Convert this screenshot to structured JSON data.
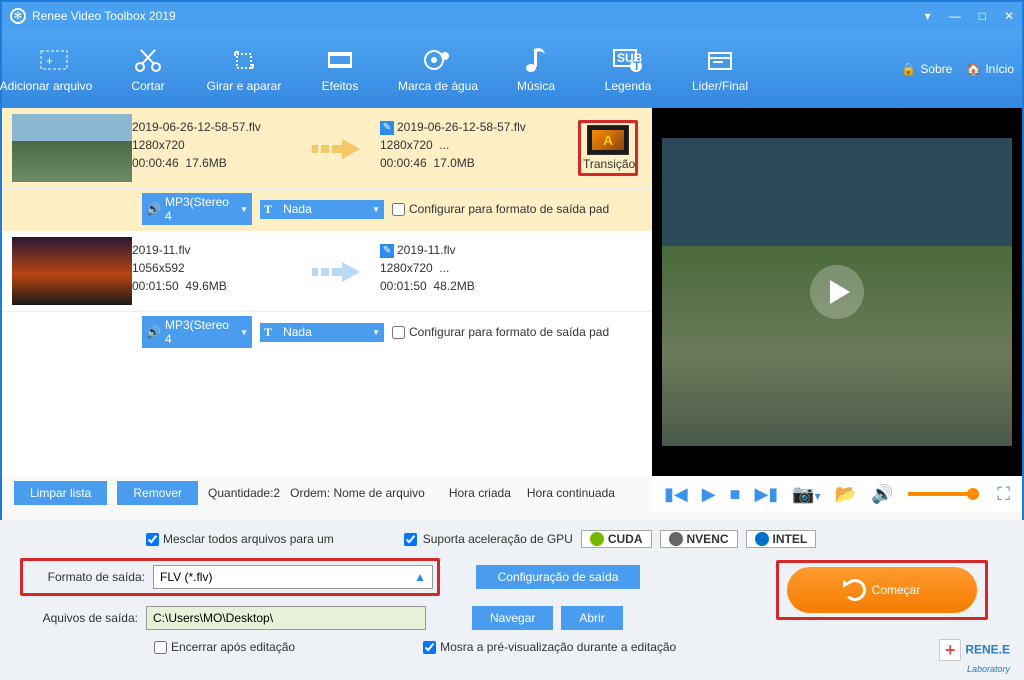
{
  "app": {
    "title": "Renee Video Toolbox 2019"
  },
  "header_right": {
    "about": "Sobre",
    "home": "Início"
  },
  "toolbar": [
    {
      "label": "Adicionar arquivo"
    },
    {
      "label": "Cortar"
    },
    {
      "label": "Girar e aparar"
    },
    {
      "label": "Efeitos"
    },
    {
      "label": "Marca de água"
    },
    {
      "label": "Música"
    },
    {
      "label": "Legenda"
    },
    {
      "label": "Lider/Final"
    }
  ],
  "files": [
    {
      "name": "2019-06-26-12-58-57.flv",
      "res": "1280x720",
      "dur": "00:00:46",
      "size": "17.6MB",
      "out_name": "2019-06-26-12-58-57.flv",
      "out_res": "1280x720",
      "out_ext": "...",
      "out_dur": "00:00:46",
      "out_size": "17.0MB",
      "chip_audio": "MP3(Stereo 4",
      "chip_t": "Nada",
      "checkbox": "Configurar para formato de saída pad",
      "transition": "Transição",
      "selected": true
    },
    {
      "name": "2019-11.flv",
      "res": "1056x592",
      "dur": "00:01:50",
      "size": "49.6MB",
      "out_name": "2019-11.flv",
      "out_res": "1280x720",
      "out_ext": "...",
      "out_dur": "00:01:50",
      "out_size": "48.2MB",
      "chip_audio": "MP3(Stereo 4",
      "chip_t": "Nada",
      "checkbox": "Configurar para formato de saída pad",
      "selected": false
    }
  ],
  "listbar": {
    "clear": "Limpar lista",
    "remove": "Remover",
    "qty_label": "Quantidade:2",
    "order_label": "Ordem: Nome de arquivo",
    "time_created": "Hora criada",
    "time_cont": "Hora continuada"
  },
  "bottom": {
    "merge": "Mesclar todos arquivos para um",
    "gpu": "Suporta aceleração de GPU",
    "cuda": "CUDA",
    "nvenc": "NVENC",
    "intel": "INTEL",
    "format_label": "Formato de saída:",
    "format_value": "FLV (*.flv)",
    "config": "Configuração de saída",
    "path_label": "Aquivos de saída:",
    "path_value": "C:\\Users\\MO\\Desktop\\",
    "browse": "Navegar",
    "open": "Abrir",
    "close_after": "Encerrar após editação",
    "show_preview": "Mosra a pré-visualização durante a editação",
    "start": "Começar"
  },
  "brand": {
    "name": "RENE.E",
    "sub": "Laboratory"
  }
}
